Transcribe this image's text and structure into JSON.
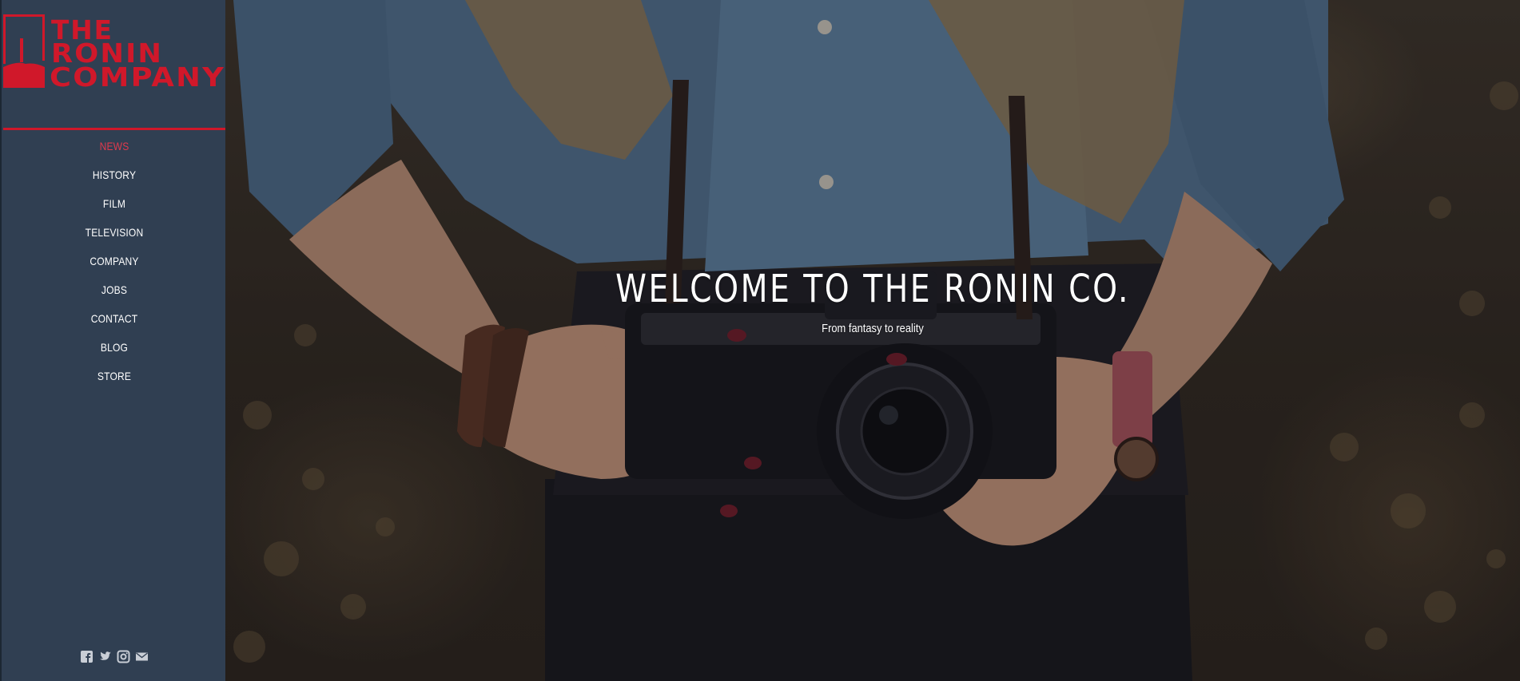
{
  "logo": {
    "lines": [
      "THE",
      "RONIN",
      "COMPANY"
    ],
    "color": "#d0182a"
  },
  "nav": {
    "items": [
      {
        "label": "NEWS",
        "active": true
      },
      {
        "label": "HISTORY"
      },
      {
        "label": "FILM"
      },
      {
        "label": "TELEVISION"
      },
      {
        "label": "COMPANY"
      },
      {
        "label": "JOBS"
      },
      {
        "label": "CONTACT"
      },
      {
        "label": "BLOG"
      },
      {
        "label": "STORE"
      }
    ]
  },
  "social": [
    "facebook-icon",
    "twitter-icon",
    "instagram-icon",
    "mail-icon"
  ],
  "hero": {
    "title": "WELCOME TO THE RONIN CO.",
    "subtitle": "From fantasy to reality"
  },
  "colors": {
    "sidebar_bg": "#303f52",
    "accent": "#d0182a",
    "active_nav": "#e0394c",
    "text": "#ffffff"
  }
}
